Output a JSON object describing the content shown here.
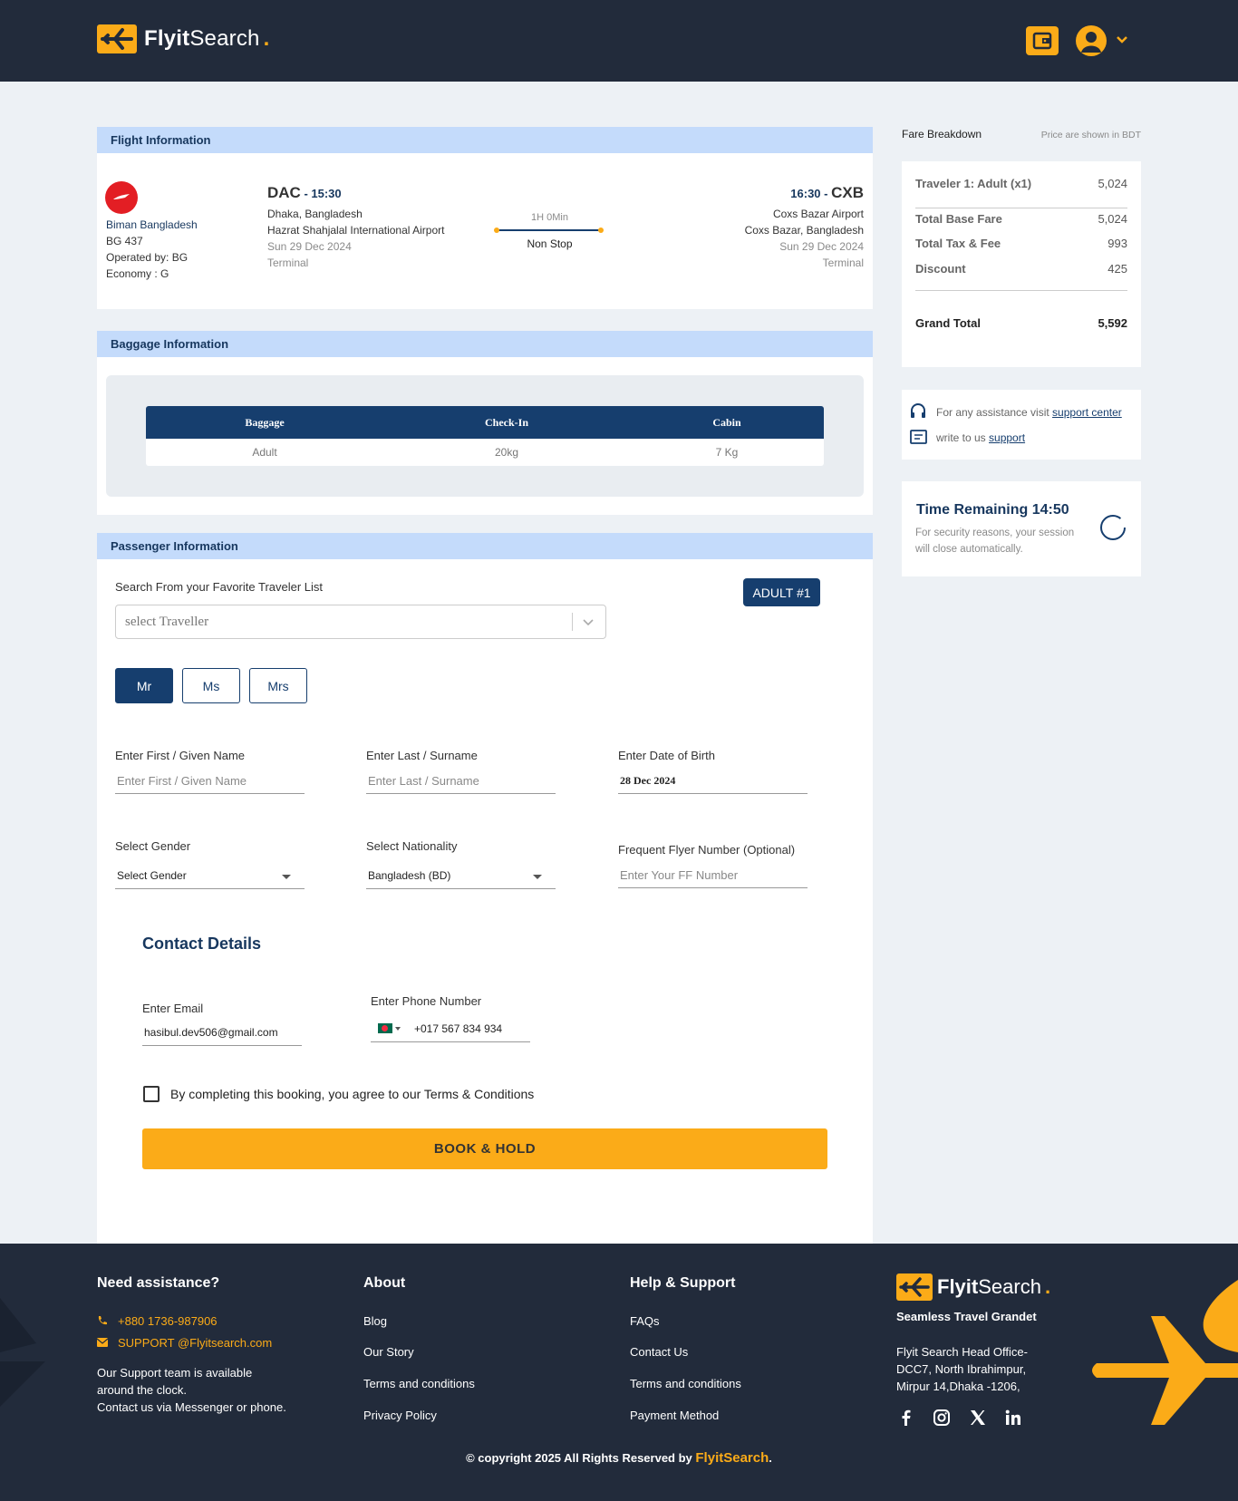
{
  "header": {
    "logo_bold": "Flyit",
    "logo_light": "Search",
    "logo_dot": ".",
    "wallet_icon": "wallet-icon",
    "user_icon": "user-circle-icon"
  },
  "flight": {
    "section_title": "Flight Information",
    "airline": "Biman Bangladesh",
    "flight_no": "BG 437",
    "operated_by": "Operated by: BG",
    "cabin_class": "Economy : G",
    "origin": {
      "code": "DAC",
      "time": " - 15:30",
      "city": "Dhaka, Bangladesh",
      "airport": "Hazrat Shahjalal International Airport",
      "date": "Sun 29 Dec 2024",
      "terminal": "Terminal"
    },
    "destination": {
      "code": "CXB",
      "time": "16:30 - ",
      "airport": "Coxs Bazar Airport",
      "city": "Coxs Bazar, Bangladesh",
      "date": "Sun 29 Dec 2024",
      "terminal": "Terminal"
    },
    "duration": "1H 0Min",
    "stops": "Non Stop"
  },
  "baggage": {
    "section_title": "Baggage Information",
    "headers": [
      "Baggage",
      "Check-In",
      "Cabin"
    ],
    "rows": [
      [
        "Adult",
        "20kg",
        "7 Kg"
      ]
    ]
  },
  "passenger": {
    "section_title": "Passenger Information",
    "search_label": "Search From your Favorite Traveler List",
    "select_placeholder": "select Traveller",
    "badge": "ADULT #1",
    "titles": [
      "Mr",
      "Ms",
      "Mrs"
    ],
    "active_title": "Mr",
    "first_name_label": "Enter First / Given Name",
    "first_name_placeholder": "Enter First / Given Name",
    "last_name_label": "Enter Last / Surname",
    "last_name_placeholder": "Enter Last / Surname",
    "dob_label": "Enter Date of Birth",
    "dob_value": "28 Dec 2024",
    "gender_label": "Select Gender",
    "gender_value": "Select Gender",
    "nationality_label": "Select Nationality",
    "nationality_value": "Bangladesh (BD)",
    "ff_label": "Frequent Flyer Number (Optional)",
    "ff_placeholder": "Enter Your FF Number"
  },
  "contact": {
    "title": "Contact Details",
    "email_label": "Enter Email",
    "email_value": "hasibul.dev506@gmail.com",
    "phone_label": "Enter Phone Number",
    "phone_value": "+017 567 834 934",
    "terms_text": "By completing this booking, you agree to our Terms & Conditions",
    "book_button": "BOOK & HOLD"
  },
  "fare": {
    "title": "Fare Breakdown",
    "currency_note": "Price are shown in BDT",
    "traveler_label": "Traveler 1: Adult (x1)",
    "traveler_value": "5,024",
    "base_fare_label": "Total Base Fare",
    "base_fare_value": "5,024",
    "tax_label": "Total Tax & Fee",
    "tax_value": "993",
    "discount_label": "Discount",
    "discount_value": "425",
    "grand_total_label": "Grand Total",
    "grand_total_value": "5,592"
  },
  "assist": {
    "visit_text": "For any assistance visit ",
    "visit_link": "support center",
    "write_text": "write to us ",
    "write_link": "support"
  },
  "timer": {
    "title": "Time Remaining 14:50",
    "line1": "For security reasons, your session",
    "line2": "will close automatically."
  },
  "footer": {
    "assist_title": "Need assistance?",
    "phone": "+880 1736-987906",
    "email": "SUPPORT @Flyitsearch.com",
    "assist_line1": "Our Support team is available",
    "assist_line2": "around the clock.",
    "assist_line3": "Contact us via Messenger or phone.",
    "about_title": "About",
    "about_links": [
      "Blog",
      "Our Story",
      "Terms and conditions",
      "Privacy Policy"
    ],
    "help_title": "Help & Support",
    "help_links": [
      "FAQs",
      "Contact Us",
      "Terms and conditions",
      "Payment Method"
    ],
    "tagline": "Seamless Travel Grandet",
    "address1": "Flyit Search Head Office-",
    "address2": "DCC7, North Ibrahimpur,",
    "address3": "Mirpur 14,Dhaka -1206,",
    "copyright": "© copyright 2025 All Rights Reserved by ",
    "copyright_brand": "FlyitSearch",
    "copyright_end": "."
  },
  "colors": {
    "accent": "#fbab18",
    "navy": "#163e6e",
    "header_bg": "#222b3b",
    "section_head": "#c4dbfb"
  }
}
